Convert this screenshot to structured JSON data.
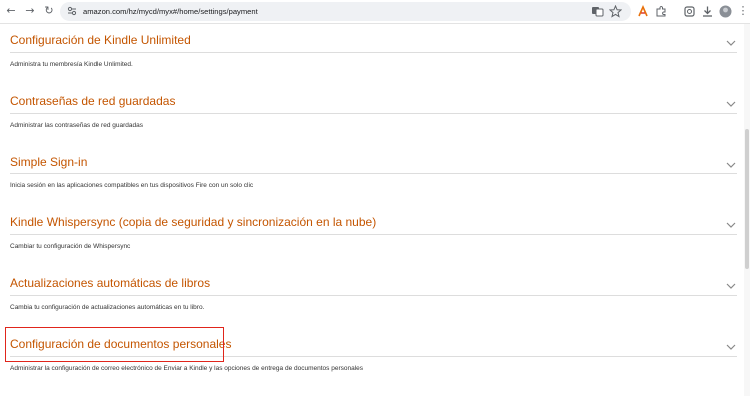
{
  "browser": {
    "url": "amazon.com/hz/mycd/myx#/home/settings/payment"
  },
  "sections": [
    {
      "title": "Configuración de Kindle Unlimited",
      "description": "Administra tu membresía Kindle Unlimited."
    },
    {
      "title": "Contraseñas de red guardadas",
      "description": "Administrar las contraseñas de red guardadas"
    },
    {
      "title": "Simple Sign-in",
      "description": "Inicia sesión en las aplicaciones compatibles en tus dispositivos Fire con un solo clic"
    },
    {
      "title": "Kindle Whispersync (copia de seguridad y sincronización en la nube)",
      "description": "Cambiar tu configuración de Whispersync"
    },
    {
      "title": "Actualizaciones automáticas de libros",
      "description": "Cambia tu configuración de actualizaciones automáticas en tu libro."
    },
    {
      "title": "Configuración de documentos personales",
      "description": "Administrar la configuración de correo electrónico de Enviar a Kindle y las opciones de entrega de documentos personales"
    }
  ],
  "colors": {
    "section_title": "#c45500",
    "highlight_box": "#e0251b"
  }
}
